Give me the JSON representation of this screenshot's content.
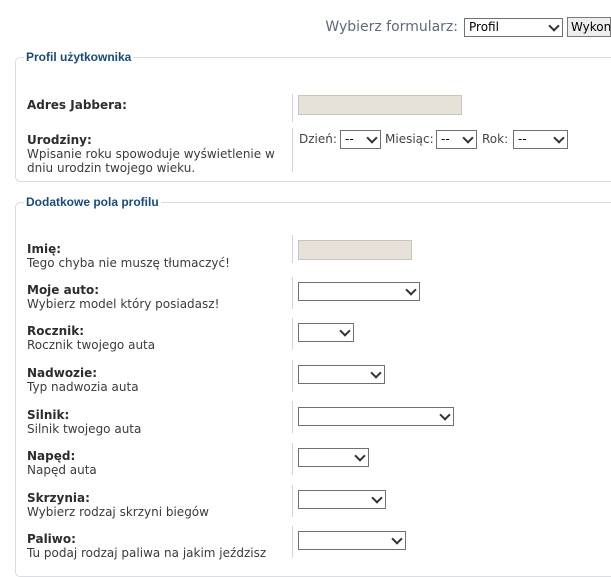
{
  "topbar": {
    "label": "Wybierz formularz:",
    "select_value": "Profil",
    "button_label": "Wykonaj"
  },
  "profile": {
    "legend": "Profil użytkownika",
    "jabber": {
      "label": "Adres Jabbera:"
    },
    "birthday": {
      "label": "Urodziny:",
      "desc1": "Wpisanie roku spowoduje wyświetlenie w",
      "desc2": "dniu urodzin twojego wieku.",
      "day_label": "Dzień:",
      "day_value": "--",
      "month_label": "Miesiąc:",
      "month_value": "--",
      "year_label": "Rok:",
      "year_value": "--"
    }
  },
  "extra": {
    "legend": "Dodatkowe pola profilu",
    "fields": [
      {
        "label": "Imię:",
        "desc": "Tego chyba nie muszę tłumaczyć!"
      },
      {
        "label": "Moje auto:",
        "desc": "Wybierz model który posiadasz!"
      },
      {
        "label": "Rocznik:",
        "desc": "Rocznik twojego auta"
      },
      {
        "label": "Nadwozie:",
        "desc": "Typ nadwozia auta"
      },
      {
        "label": "Silnik:",
        "desc": "Silnik twojego auta"
      },
      {
        "label": "Napęd:",
        "desc": "Napęd auta"
      },
      {
        "label": "Skrzynia:",
        "desc": "Wybierz rodzaj skrzyni biegów"
      },
      {
        "label": "Paliwo:",
        "desc": "Tu podaj rodzaj paliwa na jakim jeździsz"
      }
    ]
  }
}
